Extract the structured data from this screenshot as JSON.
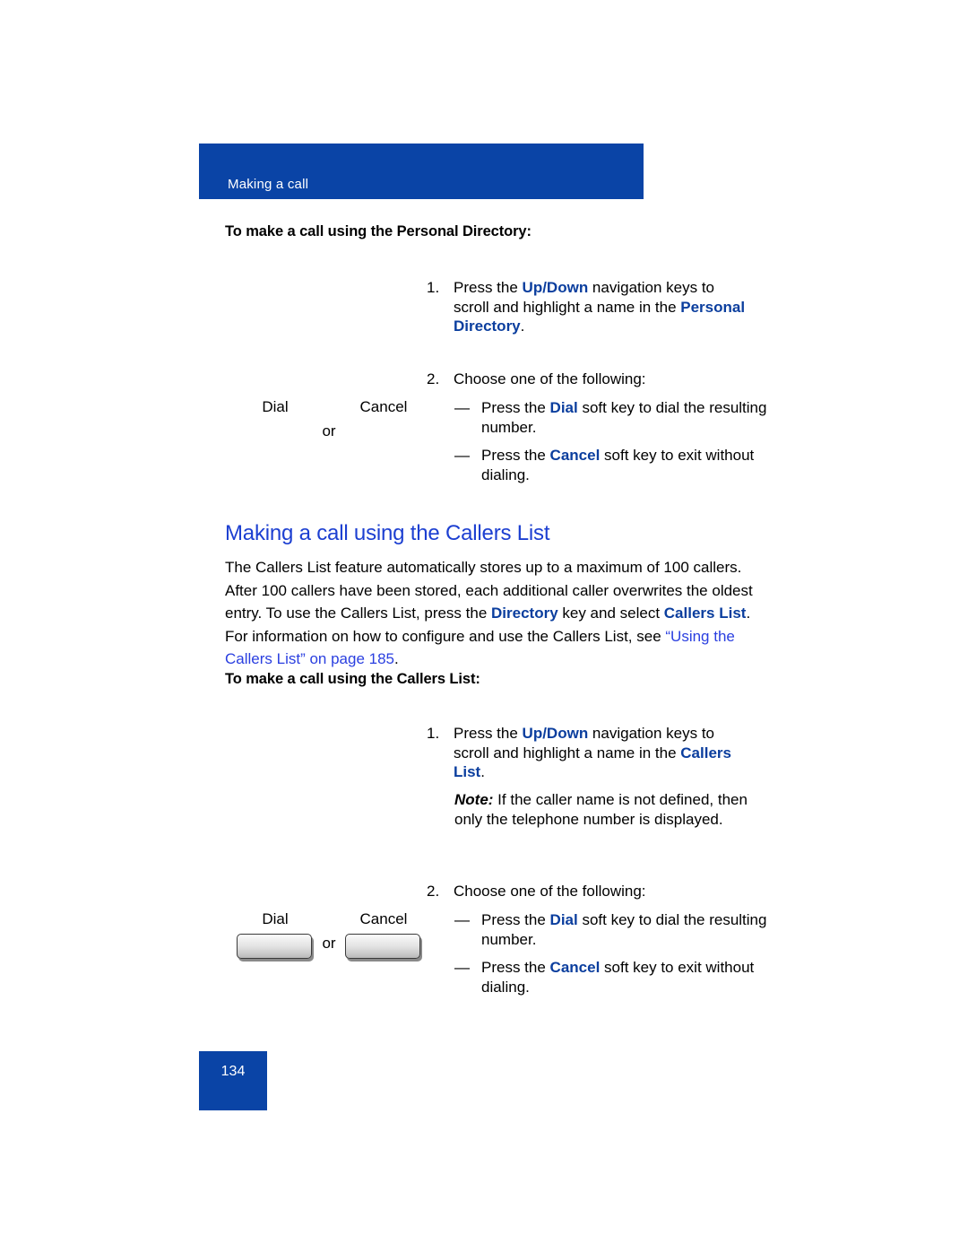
{
  "page": {
    "running_header": "Making a call",
    "page_number": "134",
    "accent_blue": "#0a44a6",
    "heading_blue": "#1c3fd1",
    "term_blue": "#0b3e9e",
    "link_blue": "#2a3fe0"
  },
  "procedure_1": {
    "heading": "To make a call using the Personal Directory:",
    "steps": [
      {
        "number": "1.",
        "text_parts": [
          {
            "text": "Press the ",
            "style": "normal"
          },
          {
            "text": "Up/Down",
            "style": "bold-blue"
          },
          {
            "text": " navigation keys to scroll and highlight a name in the ",
            "style": "normal"
          },
          {
            "text": "Personal Directory",
            "style": "bold-blue"
          },
          {
            "text": ".",
            "style": "normal"
          }
        ]
      },
      {
        "number": "2.",
        "text_parts": [
          {
            "text": "Choose one of the following:",
            "style": "normal"
          }
        ]
      }
    ],
    "dash_items": [
      {
        "mark": "—",
        "text_parts": [
          {
            "text": "Press the ",
            "style": "normal"
          },
          {
            "text": "Dial",
            "style": "bold-blue"
          },
          {
            "text": " soft key to dial the resulting number.",
            "style": "normal"
          }
        ]
      },
      {
        "mark": "—",
        "text_parts": [
          {
            "text": "Press the ",
            "style": "normal"
          },
          {
            "text": "Cancel",
            "style": "bold-blue"
          },
          {
            "text": " soft key to exit without dialing.",
            "style": "normal"
          }
        ]
      }
    ],
    "softkeys": {
      "dial_label": "Dial",
      "cancel_label": "Cancel",
      "or_label": "or",
      "buttons_visible": false
    }
  },
  "section": {
    "heading": "Making a call using the Callers List",
    "paragraph_parts": [
      {
        "text": "The Callers List feature automatically stores up to a maximum of 100 callers. After 100 callers have been stored, each additional caller overwrites the oldest entry. To use the Callers List, press the ",
        "style": "normal"
      },
      {
        "text": "Directory",
        "style": "bold-blue"
      },
      {
        "text": " key and select ",
        "style": "normal"
      },
      {
        "text": "Callers List",
        "style": "bold-blue"
      },
      {
        "text": ". For information on how to configure and use the Callers List, see ",
        "style": "normal"
      },
      {
        "text": "“Using the Callers List” on page 185",
        "style": "link"
      },
      {
        "text": ".",
        "style": "normal"
      }
    ]
  },
  "procedure_2": {
    "heading": "To make a call using the Callers List:",
    "steps": [
      {
        "number": "1.",
        "text_parts": [
          {
            "text": "Press the ",
            "style": "normal"
          },
          {
            "text": "Up/Down",
            "style": "bold-blue"
          },
          {
            "text": " navigation keys to scroll and highlight a name in the ",
            "style": "normal"
          },
          {
            "text": "Callers List",
            "style": "bold-blue"
          },
          {
            "text": ".",
            "style": "normal"
          }
        ]
      },
      {
        "number": "2.",
        "text_parts": [
          {
            "text": "Choose one of the following:",
            "style": "normal"
          }
        ]
      }
    ],
    "note": {
      "label": "Note:",
      "text": " If the caller name is not defined, then only the telephone number is displayed."
    },
    "dash_items": [
      {
        "mark": "—",
        "text_parts": [
          {
            "text": "Press the ",
            "style": "normal"
          },
          {
            "text": "Dial",
            "style": "bold-blue"
          },
          {
            "text": " soft key to dial the resulting number.",
            "style": "normal"
          }
        ]
      },
      {
        "mark": "—",
        "text_parts": [
          {
            "text": "Press the ",
            "style": "normal"
          },
          {
            "text": "Cancel",
            "style": "bold-blue"
          },
          {
            "text": " soft key to exit without dialing.",
            "style": "normal"
          }
        ]
      }
    ],
    "softkeys": {
      "dial_label": "Dial",
      "cancel_label": "Cancel",
      "or_label": "or",
      "buttons_visible": true
    }
  }
}
